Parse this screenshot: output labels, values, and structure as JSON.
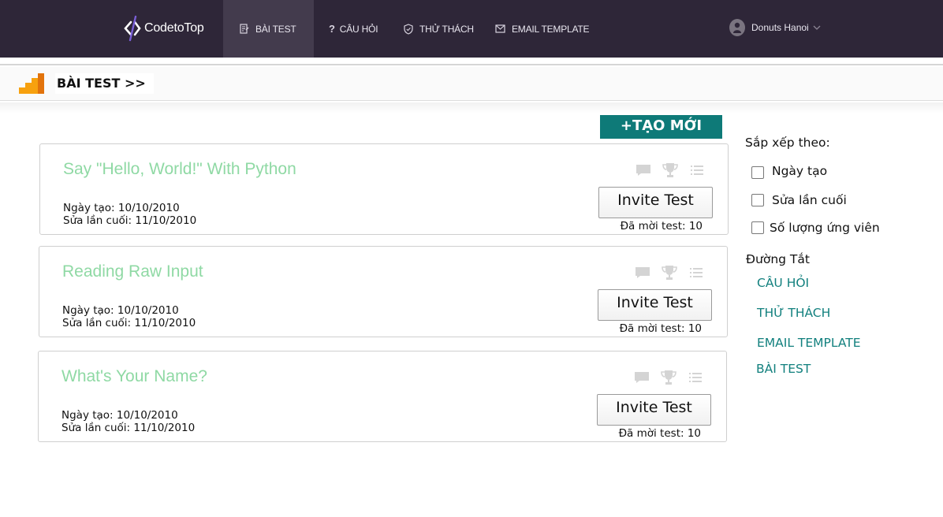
{
  "nav": {
    "logo_text": "CodetoTop",
    "items": [
      {
        "label": "BÀI TEST",
        "icon": "document-icon",
        "active": true
      },
      {
        "label": "CÂU HỎI",
        "icon": "question-icon",
        "active": false
      },
      {
        "label": "THỬ THÁCH",
        "icon": "shield-icon",
        "active": false
      },
      {
        "label": "EMAIL TEMPLATE",
        "icon": "envelope-icon",
        "active": false
      }
    ],
    "user_name": "Donuts Hanoi"
  },
  "breadcrumb": {
    "label": "BÀI TEST >>"
  },
  "create_button": "+TẠO MỚI",
  "tests": [
    {
      "title": "Say \"Hello, World!\" With Python",
      "created": "Ngày tạo: 10/10/2010",
      "modified": "Sửa lần cuối: 11/10/2010",
      "invite_label": "Invite Test",
      "invited": "Đã mời test: 10"
    },
    {
      "title": "Reading Raw Input",
      "created": "Ngày tạo: 10/10/2010",
      "modified": "Sửa lần cuối: 11/10/2010",
      "invite_label": "Invite Test",
      "invited": "Đã mời test: 10"
    },
    {
      "title": "What's Your Name?",
      "created": "Ngày tạo: 10/10/2010",
      "modified": "Sửa lần cuối: 11/10/2010",
      "invite_label": "Invite Test",
      "invited": "Đã mời test: 10"
    }
  ],
  "sidebar": {
    "sort_title": "Sắp xếp theo:",
    "sort_options": [
      "Ngày tạo",
      "Sửa lần cuối",
      "Số lượng ứng viên"
    ],
    "shortcut_title": "Đường Tắt",
    "shortcuts": [
      "CÂU HỎI",
      "THỬ THÁCH",
      "EMAIL TEMPLATE",
      "BÀI TEST"
    ]
  },
  "colors": {
    "topbar": "#2e2638",
    "accent_teal": "#0e7a78",
    "title_green": "#8fd9a4",
    "link_teal": "#12807e"
  }
}
